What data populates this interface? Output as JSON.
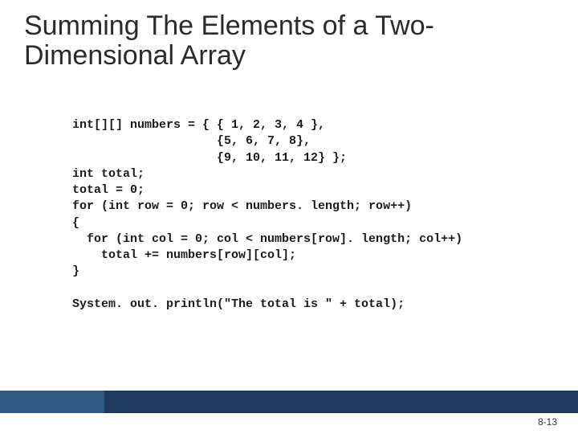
{
  "title": "Summing The Elements of a Two-Dimensional Array",
  "code": "int[][] numbers = { { 1, 2, 3, 4 },\n                    {5, 6, 7, 8},\n                    {9, 10, 11, 12} };\nint total;\ntotal = 0;\nfor (int row = 0; row < numbers. length; row++)\n{\n  for (int col = 0; col < numbers[row]. length; col++)\n    total += numbers[row][col];\n}\n\nSystem. out. println(\"The total is \" + total);",
  "page": "8-13"
}
